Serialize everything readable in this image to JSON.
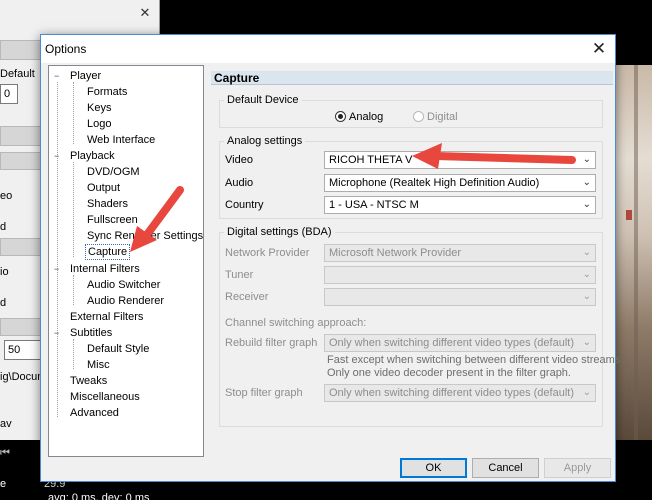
{
  "background": {
    "left_labels": [
      "Default",
      "0",
      "50",
      "eo",
      "d",
      "io",
      "d",
      "ig\\Docum",
      "av"
    ],
    "stats": {
      "line1_label": "e",
      "line1_value": "29.9",
      "line2": "avg: 0 ms, dev: 0 ms"
    }
  },
  "dialog": {
    "title": "Options",
    "tree": [
      {
        "label": "Player",
        "expander": "-"
      },
      {
        "label": "Formats"
      },
      {
        "label": "Keys"
      },
      {
        "label": "Logo"
      },
      {
        "label": "Web Interface"
      },
      {
        "label": "Playback",
        "expander": "-"
      },
      {
        "label": "DVD/OGM"
      },
      {
        "label": "Output"
      },
      {
        "label": "Shaders"
      },
      {
        "label": "Fullscreen"
      },
      {
        "label": "Sync Renderer Settings"
      },
      {
        "label": "Capture"
      },
      {
        "label": "Internal Filters",
        "expander": "-"
      },
      {
        "label": "Audio Switcher"
      },
      {
        "label": "Audio Renderer"
      },
      {
        "label": "External Filters"
      },
      {
        "label": "Subtitles",
        "expander": "-"
      },
      {
        "label": "Default Style"
      },
      {
        "label": "Misc"
      },
      {
        "label": "Tweaks"
      },
      {
        "label": "Miscellaneous"
      },
      {
        "label": "Advanced"
      }
    ],
    "panel_title": "Capture",
    "default_device": {
      "title": "Default Device",
      "analog_label": "Analog",
      "digital_label": "Digital",
      "selected": "Analog"
    },
    "analog": {
      "title": "Analog settings",
      "video_label": "Video",
      "video_value": "RICOH THETA V",
      "audio_label": "Audio",
      "audio_value": "Microphone (Realtek High Definition Audio)",
      "country_label": "Country",
      "country_value": "1 - USA - NTSC M"
    },
    "digital": {
      "title": "Digital settings (BDA)",
      "network_label": "Network Provider",
      "network_value": "Microsoft Network Provider",
      "tuner_label": "Tuner",
      "tuner_value": "",
      "receiver_label": "Receiver",
      "receiver_value": "",
      "channel_label": "Channel switching approach:",
      "rebuild_label": "Rebuild filter graph",
      "rebuild_value": "Only when switching different video types (default)",
      "note_line1": "Fast except when switching between different video streams.",
      "note_line2": "Only one video decoder present in the filter graph.",
      "stop_label": "Stop filter graph",
      "stop_value": "Only when switching different video types (default)"
    },
    "buttons": {
      "ok": "OK",
      "cancel": "Cancel",
      "apply": "Apply"
    }
  },
  "annotation_color": "#e8473e"
}
